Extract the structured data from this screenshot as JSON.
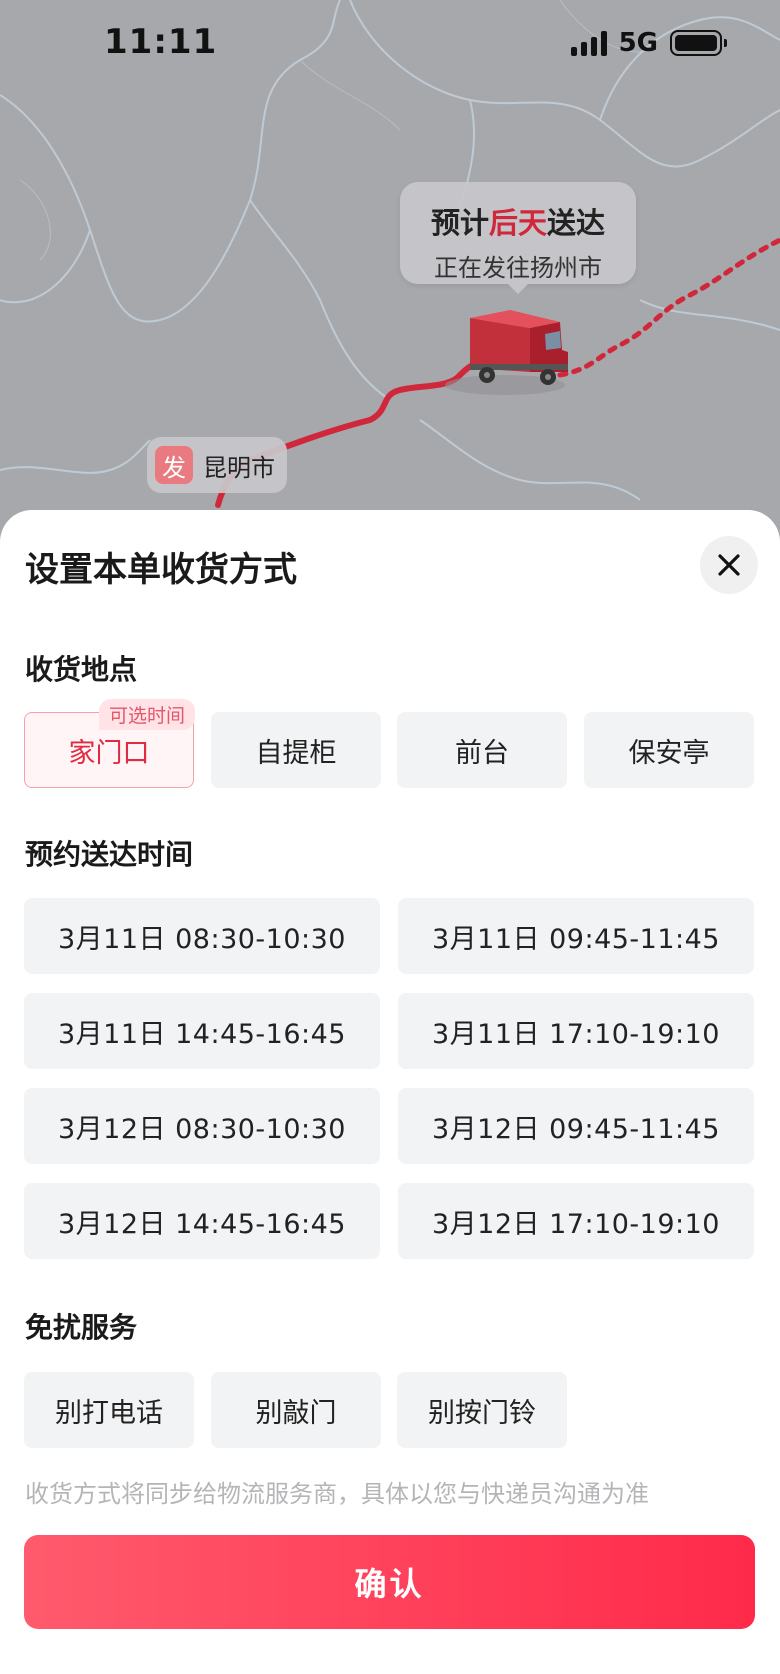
{
  "status_bar": {
    "time": "11:11",
    "network": "5G"
  },
  "map": {
    "eta": {
      "prefix": "预计",
      "highlight": "后天",
      "suffix": "送达",
      "status": "正在发往扬州市"
    },
    "origin": {
      "badge": "发",
      "city": "昆明市"
    },
    "colors": {
      "route": "#d0283a",
      "land": "#a7a8ac",
      "border": "#c9d6e3"
    }
  },
  "sheet": {
    "title": "设置本单收货方式",
    "close_icon": "close-icon",
    "location": {
      "title": "收货地点",
      "options": [
        {
          "label": "家门口",
          "badge": "可选时间",
          "selected": true
        },
        {
          "label": "自提柜",
          "selected": false
        },
        {
          "label": "前台",
          "selected": false
        },
        {
          "label": "保安亭",
          "selected": false
        }
      ]
    },
    "schedule": {
      "title": "预约送达时间",
      "slots": [
        "3月11日 08:30-10:30",
        "3月11日 09:45-11:45",
        "3月11日 14:45-16:45",
        "3月11日 17:10-19:10",
        "3月12日 08:30-10:30",
        "3月12日 09:45-11:45",
        "3月12日 14:45-16:45",
        "3月12日 17:10-19:10"
      ]
    },
    "no_disturb": {
      "title": "免扰服务",
      "options": [
        "别打电话",
        "别敲门",
        "别按门铃"
      ]
    },
    "footnote": "收货方式将同步给物流服务商，具体以您与快递员沟通为准",
    "confirm_label": "确认",
    "accent_color": "#ff2a4a"
  }
}
